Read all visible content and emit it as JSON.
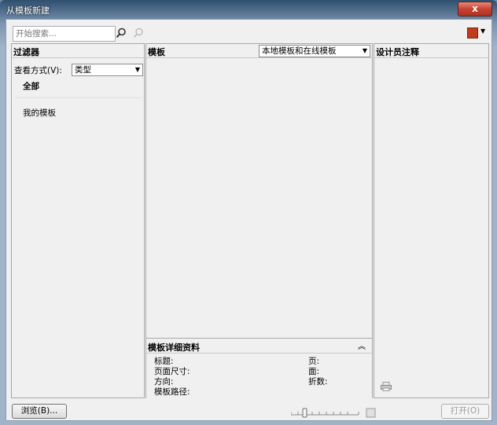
{
  "window": {
    "title": "从模板新建",
    "close_label": "x"
  },
  "search": {
    "placeholder": "开始搜索..."
  },
  "filter": {
    "header": "过滤器",
    "view_label": "查看方式(V):",
    "view_value": "类型",
    "items": [
      "全部",
      "我的模板"
    ]
  },
  "templates": {
    "header": "模板",
    "source_value": "本地模板和在线模板"
  },
  "notes": {
    "header": "设计员注释"
  },
  "details": {
    "header": "模板详细资料",
    "left_fields": [
      "标题:",
      "页面尺寸:",
      "方向:",
      "模板路径:"
    ],
    "right_fields": [
      "页:",
      "面:",
      "折数:"
    ]
  },
  "footer": {
    "browse_label": "浏览(B)...",
    "open_label": "打开(O)"
  }
}
